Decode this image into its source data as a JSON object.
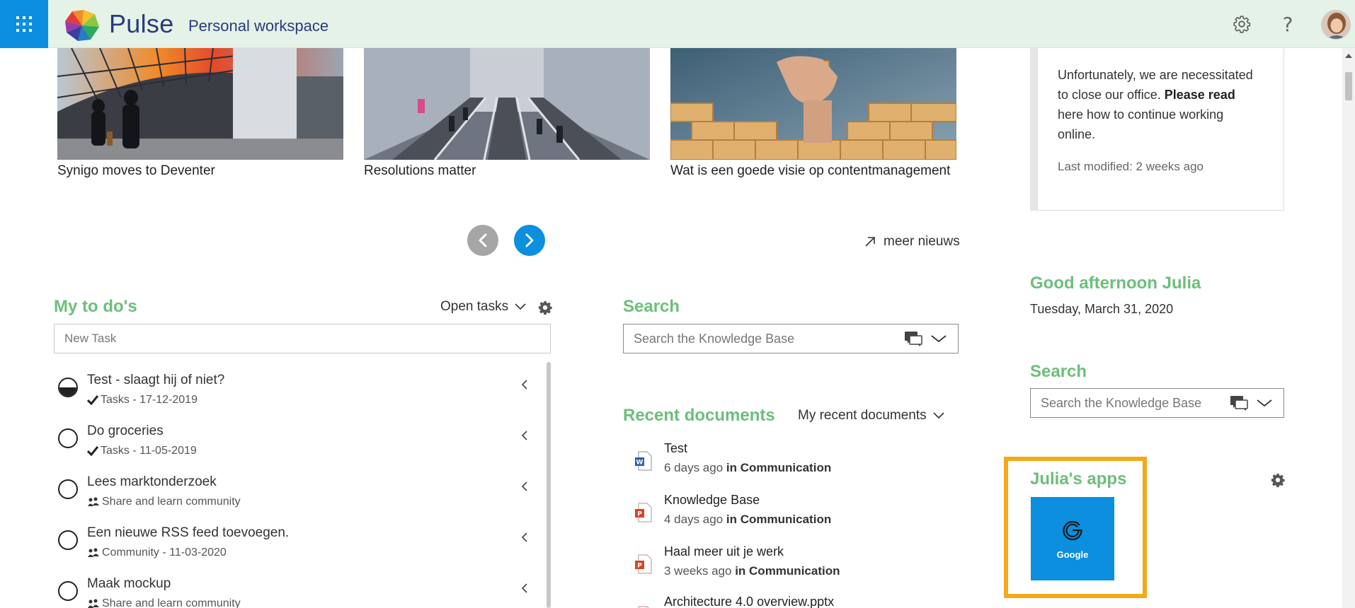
{
  "colors": {
    "accent_blue": "#0b8fde",
    "heading_green": "#6cbf7a",
    "topbar_bg": "#e5f2e7",
    "brand_navy": "#2a3a7d",
    "highlight_orange": "#f5a818"
  },
  "header": {
    "brand": "Pulse",
    "workspace": "Personal workspace",
    "icons": [
      "waffle-icon",
      "settings-icon",
      "help-icon",
      "avatar"
    ],
    "help_glyph": "?"
  },
  "news": {
    "items": [
      {
        "title": "Synigo moves to Deventer"
      },
      {
        "title": "Resolutions matter"
      },
      {
        "title": "Wat is een goede visie op contentmanagement"
      }
    ],
    "more_label": "meer nieuws"
  },
  "notice": {
    "text_before": "Unfortunately, we are necessitated to close our office. ",
    "text_bold": "Please read",
    "text_after": " here how to continue working online.",
    "modified": "Last modified: 2 weeks ago"
  },
  "todos": {
    "heading": "My to do's",
    "filter_label": "Open tasks",
    "new_task_placeholder": "New Task",
    "items": [
      {
        "title": "Test - slaagt hij of niet?",
        "meta": "Tasks - 17-12-2019",
        "meta_icon": "checkmark-icon",
        "state": "half"
      },
      {
        "title": "Do groceries",
        "meta": "Tasks - 11-05-2019",
        "meta_icon": "checkmark-icon",
        "state": "open"
      },
      {
        "title": "Lees marktonderzoek",
        "meta": "Share and learn community",
        "meta_icon": "community-icon",
        "state": "open"
      },
      {
        "title": "Een nieuwe RSS feed toevoegen.",
        "meta": "Community - 11-03-2020",
        "meta_icon": "community-icon",
        "state": "open"
      },
      {
        "title": "Maak mockup",
        "meta": "Share and learn community",
        "meta_icon": "community-icon",
        "state": "open"
      }
    ]
  },
  "search_main": {
    "heading": "Search",
    "placeholder": "Search the Knowledge Base"
  },
  "recent_docs": {
    "heading": "Recent documents",
    "filter_label": "My recent documents",
    "items": [
      {
        "name": "Test",
        "age": "6 days ago",
        "in_label": "in",
        "location": "Communication",
        "type": "word"
      },
      {
        "name": "Knowledge Base",
        "age": "4 days ago",
        "in_label": "in",
        "location": "Communication",
        "type": "powerpoint"
      },
      {
        "name": "Haal meer uit je werk",
        "age": "3 weeks ago",
        "in_label": "in",
        "location": "Communication",
        "type": "powerpoint"
      },
      {
        "name": "Architecture 4.0 overview.pptx",
        "age": "",
        "in_label": "",
        "location": "",
        "type": "powerpoint"
      }
    ]
  },
  "greeting": {
    "title": "Good afternoon Julia",
    "date": "Tuesday, March 31, 2020"
  },
  "search_side": {
    "heading": "Search",
    "placeholder": "Search the Knowledge Base"
  },
  "apps": {
    "heading": "Julia's apps",
    "items": [
      {
        "label": "Google",
        "icon": "google-icon"
      }
    ]
  }
}
